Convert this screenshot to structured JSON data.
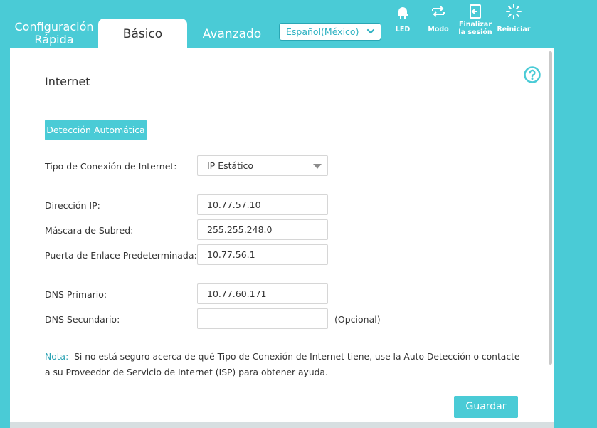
{
  "header": {
    "quick_setup_label": "Configuración Rápida",
    "basic_tab_label": "Básico",
    "advanced_tab_label": "Avanzado",
    "language": {
      "selected": "Español(México)"
    },
    "buttons": {
      "led": "LED",
      "mode": "Modo",
      "logout": "Finalizar la sesión",
      "reboot": "Reiniciar"
    }
  },
  "section": {
    "title": "Internet"
  },
  "auto_detect_label": "Detección Automática",
  "form": {
    "connection_type": {
      "label": "Tipo de Conexión de Internet:",
      "value": "IP Estático"
    },
    "ip_address": {
      "label": "Dirección IP:",
      "value": "10.77.57.10"
    },
    "subnet_mask": {
      "label": "Máscara de Subred:",
      "value": "255.255.248.0"
    },
    "gateway": {
      "label": "Puerta de Enlace Predeterminada:",
      "value": "10.77.56.1"
    },
    "dns_primary": {
      "label": "DNS Primario:",
      "value": "10.77.60.171"
    },
    "dns_secondary": {
      "label": "DNS Secundario:",
      "value": "",
      "hint": "(Opcional)"
    }
  },
  "note": {
    "label": "Nota:",
    "text": "Si no está seguro acerca de qué Tipo de Conexión de Internet tiene, use la Auto Detección o contacte a su Proveedor de Servicio de Internet (ISP) para obtener ayuda."
  },
  "save_label": "Guardar",
  "colors": {
    "accent": "#4acbd6",
    "note_label": "#2ca3b4",
    "text": "#333333"
  }
}
